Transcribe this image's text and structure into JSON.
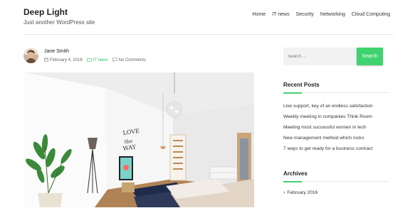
{
  "site": {
    "title": "Deep Light",
    "tagline": "Just another WordPress site"
  },
  "nav": {
    "items": [
      "Home",
      "IT news",
      "Security",
      "Networking",
      "Cloud Computing"
    ]
  },
  "post": {
    "author": "Jane Smith",
    "date": "February 4, 2016",
    "category": "IT news",
    "comments": "No Comments"
  },
  "sidebar": {
    "search": {
      "placeholder": "Search ...",
      "button_label": "Search"
    },
    "recent_posts": {
      "title": "Recent Posts",
      "items": [
        "Live support, key of an endless satisfaction",
        "Weekly meeting in companies Think Room",
        "Meeting most successful women in tech",
        "New management method which rocks",
        "7 ways to get ready for a business contract"
      ]
    },
    "archives": {
      "title": "Archives",
      "items": [
        "February 2016"
      ]
    }
  },
  "colors": {
    "accent": "#3ed36e",
    "category_link": "#27c46a"
  },
  "icons": [
    "calendar-icon",
    "folder-icon",
    "comment-icon",
    "chevron-right-icon"
  ]
}
